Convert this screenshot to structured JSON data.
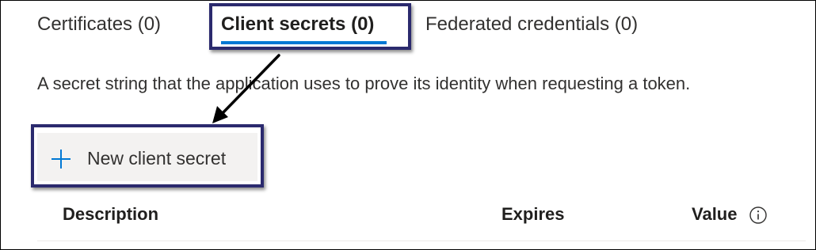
{
  "tabs": {
    "certificates": "Certificates (0)",
    "client_secrets": "Client secrets (0)",
    "federated": "Federated credentials (0)"
  },
  "description": "A secret string that the application uses to prove its identity when requesting a token.",
  "new_secret_button": {
    "label": "New client secret",
    "icon": "plus-icon"
  },
  "table": {
    "columns": [
      "Description",
      "Expires",
      "Value"
    ],
    "value_info_icon": "info-icon"
  },
  "colors": {
    "accent": "#0078d4",
    "highlight_box": "#2b2a6e",
    "button_bg": "#f3f2f1",
    "text": "#323130"
  }
}
